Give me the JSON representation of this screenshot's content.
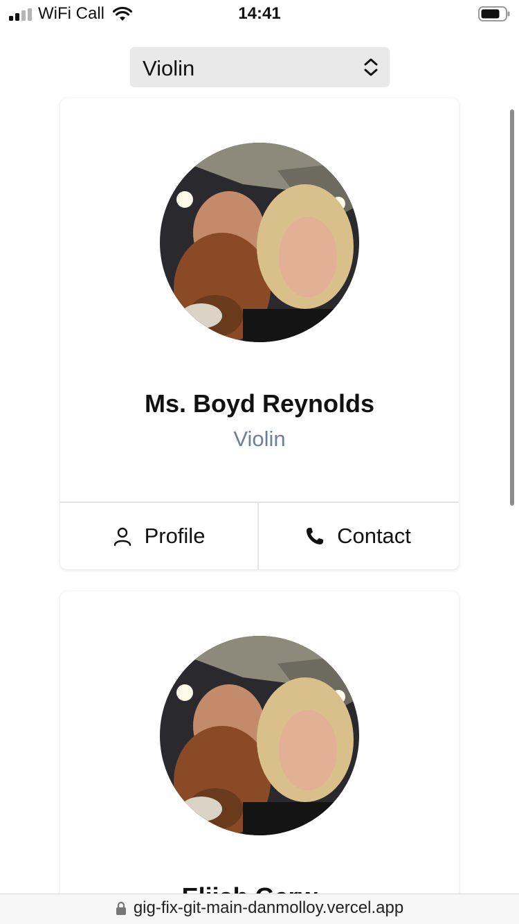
{
  "status_bar": {
    "carrier": "WiFi Call",
    "time": "14:41",
    "signal_bars_active": 2,
    "signal_bars_total": 4
  },
  "filter": {
    "selected": "Violin"
  },
  "musicians": [
    {
      "name": "Ms. Boyd Reynolds",
      "instrument": "Violin",
      "profile_label": "Profile",
      "contact_label": "Contact"
    },
    {
      "name": "Elijah Gerw..."
    }
  ],
  "browser": {
    "url": "gig-fix-git-main-danmolloy.vercel.app"
  },
  "colors": {
    "instrument_text": "#6e7f99",
    "select_bg": "#e9e9e9",
    "card_border": "#e5e5e5"
  },
  "icons": {
    "profile": "user-outline-icon",
    "contact": "phone-icon",
    "lock": "lock-icon",
    "chevron": "chevron-up-down-icon"
  }
}
